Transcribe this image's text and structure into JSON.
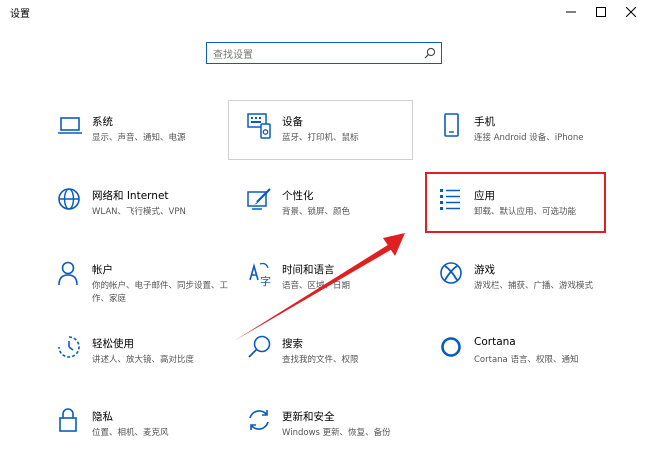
{
  "window": {
    "title": "设置"
  },
  "search": {
    "placeholder": "查找设置"
  },
  "categories": [
    {
      "title": "系统",
      "desc": "显示、声音、通知、电源",
      "icon": "laptop-icon"
    },
    {
      "title": "设备",
      "desc": "蓝牙、打印机、鼠标",
      "icon": "keyboard-icon"
    },
    {
      "title": "手机",
      "desc": "连接 Android 设备、iPhone",
      "icon": "phone-icon"
    },
    {
      "title": "网络和 Internet",
      "desc": "WLAN、飞行模式、VPN",
      "icon": "globe-icon"
    },
    {
      "title": "个性化",
      "desc": "背景、锁屏、颜色",
      "icon": "paintbrush-icon"
    },
    {
      "title": "应用",
      "desc": "卸载、默认应用、可选功能",
      "icon": "apps-list-icon"
    },
    {
      "title": "帐户",
      "desc": "你的帐户、电子邮件、同步设置、工作、家庭",
      "icon": "person-icon"
    },
    {
      "title": "时间和语言",
      "desc": "语音、区域、日期",
      "icon": "time-language-icon"
    },
    {
      "title": "游戏",
      "desc": "游戏栏、捕获、广播、游戏模式",
      "icon": "xbox-icon"
    },
    {
      "title": "轻松使用",
      "desc": "讲述人、放大镜、高对比度",
      "icon": "ease-of-access-icon"
    },
    {
      "title": "搜索",
      "desc": "查找我的文件、权限",
      "icon": "search-icon"
    },
    {
      "title": "Cortana",
      "desc": "Cortana 语言、权限、通知",
      "icon": "cortana-icon"
    },
    {
      "title": "隐私",
      "desc": "位置、相机、麦克风",
      "icon": "lock-icon"
    },
    {
      "title": "更新和安全",
      "desc": "Windows 更新、恢复、备份",
      "icon": "update-icon"
    }
  ],
  "colors": {
    "accent": "#0a5bbf",
    "highlight": "#e02020"
  }
}
